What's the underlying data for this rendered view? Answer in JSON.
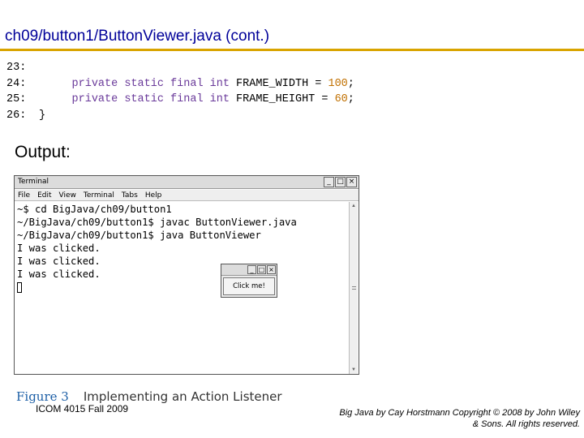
{
  "slide": {
    "title": "ch09/button1/ButtonViewer.java  (cont.)"
  },
  "code": {
    "lines": [
      {
        "num": "23:",
        "indent": "",
        "keywords": "",
        "rest": "",
        "value": "",
        "end": ""
      },
      {
        "num": "24:",
        "indent": "     ",
        "keywords": "private static final int",
        "rest": " FRAME_WIDTH = ",
        "value": "100",
        "end": ";"
      },
      {
        "num": "25:",
        "indent": "     ",
        "keywords": "private static final int",
        "rest": " FRAME_HEIGHT = ",
        "value": "60",
        "end": ";"
      },
      {
        "num": "26:",
        "indent": "",
        "keywords": "",
        "rest": "}",
        "value": "",
        "end": ""
      }
    ]
  },
  "output_label": "Output:",
  "terminal": {
    "title": "Terminal",
    "menu": [
      "File",
      "Edit",
      "View",
      "Terminal",
      "Tabs",
      "Help"
    ],
    "lines": [
      "~$ cd BigJava/ch09/button1",
      "~/BigJava/ch09/button1$ javac ButtonViewer.java",
      "~/BigJava/ch09/button1$ java ButtonViewer",
      "I was clicked.",
      "I was clicked.",
      "I was clicked."
    ],
    "window_buttons": [
      "_",
      "□",
      "×"
    ]
  },
  "mini_frame": {
    "button_label": "Click me!",
    "window_buttons": [
      "_",
      "□",
      "×"
    ]
  },
  "figure": {
    "number": "Figure 3",
    "caption": "Implementing an Action Listener"
  },
  "footer": {
    "left": "ICOM 4015 Fall 2009",
    "right_line1": "Big Java by Cay Horstmann Copyright © 2008 by John Wiley",
    "right_line2": "& Sons.  All rights reserved."
  },
  "colors": {
    "title": "#000099",
    "rule": "#d9a400",
    "keyword": "#6a3a9a",
    "number": "#c07000",
    "figure_number": "#1d5fa6"
  }
}
